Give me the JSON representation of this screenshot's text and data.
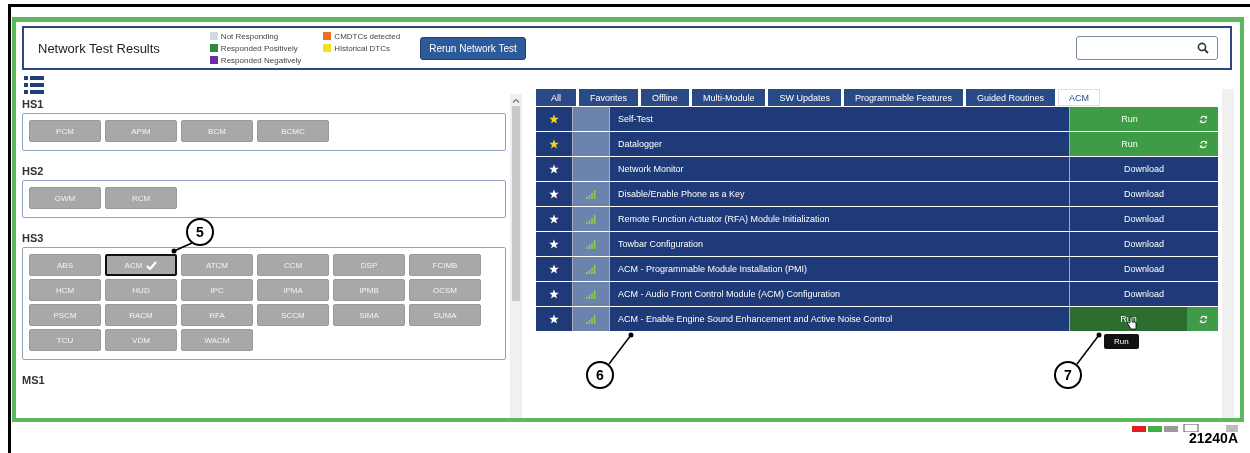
{
  "header": {
    "title": "Network Test Results",
    "legend": [
      {
        "label": "Not Responding",
        "color": "#d3d9e2"
      },
      {
        "label": "Responded Positively",
        "color": "#2e8b3e"
      },
      {
        "label": "Responded Negatively",
        "color": "#6a2fa0"
      },
      {
        "label": "CMDTCs detected",
        "color": "#f07020"
      },
      {
        "label": "Historical DTCs",
        "color": "#f5e020"
      }
    ],
    "rerun_button": "Rerun Network Test"
  },
  "groups": [
    {
      "name": "HS1",
      "modules": [
        {
          "label": "PCM",
          "selected": false
        },
        {
          "label": "APIM",
          "selected": false
        },
        {
          "label": "BCM",
          "selected": false
        },
        {
          "label": "BCMC",
          "selected": false
        }
      ]
    },
    {
      "name": "HS2",
      "modules": [
        {
          "label": "GWM",
          "selected": false
        },
        {
          "label": "RCM",
          "selected": false
        }
      ]
    },
    {
      "name": "HS3",
      "modules": [
        {
          "label": "ABS",
          "selected": false
        },
        {
          "label": "ACM",
          "selected": true
        },
        {
          "label": "ATCM",
          "selected": false
        },
        {
          "label": "CCM",
          "selected": false
        },
        {
          "label": "DSP",
          "selected": false
        },
        {
          "label": "FCIMB",
          "selected": false
        },
        {
          "label": "HCM",
          "selected": false
        },
        {
          "label": "HUD",
          "selected": false
        },
        {
          "label": "IPC",
          "selected": false
        },
        {
          "label": "IPMA",
          "selected": false
        },
        {
          "label": "IPMB",
          "selected": false
        },
        {
          "label": "OCSM",
          "selected": false
        },
        {
          "label": "PSCM",
          "selected": false
        },
        {
          "label": "RACM",
          "selected": false
        },
        {
          "label": "RFA",
          "selected": false
        },
        {
          "label": "SCCM",
          "selected": false
        },
        {
          "label": "SIMA",
          "selected": false
        },
        {
          "label": "SUMA",
          "selected": false
        },
        {
          "label": "TCU",
          "selected": false
        },
        {
          "label": "VDM",
          "selected": false
        },
        {
          "label": "WACM",
          "selected": false
        }
      ]
    },
    {
      "name": "MS1"
    }
  ],
  "tabs": [
    {
      "label": "All",
      "selected": false
    },
    {
      "label": "Favorites",
      "selected": false
    },
    {
      "label": "Offline",
      "selected": false
    },
    {
      "label": "Multi-Module",
      "selected": false
    },
    {
      "label": "SW Updates",
      "selected": false
    },
    {
      "label": "Programmable Features",
      "selected": false
    },
    {
      "label": "Guided Routines",
      "selected": false
    },
    {
      "label": "ACM",
      "selected": true
    }
  ],
  "rows": [
    {
      "favorite": true,
      "signal": false,
      "name": "Self-Test",
      "kind": "run",
      "action": "Run"
    },
    {
      "favorite": true,
      "signal": false,
      "name": "Datalogger",
      "kind": "run",
      "action": "Run"
    },
    {
      "favorite": false,
      "signal": false,
      "name": "Network Monitor",
      "kind": "download",
      "action": "Download"
    },
    {
      "favorite": false,
      "signal": true,
      "name": "Disable/Enable Phone as a Key",
      "kind": "download",
      "action": "Download"
    },
    {
      "favorite": false,
      "signal": true,
      "name": "Remote Function Actuator (RFA) Module Initialization",
      "kind": "download",
      "action": "Download"
    },
    {
      "favorite": false,
      "signal": true,
      "name": "Towbar Configuration",
      "kind": "download",
      "action": "Download"
    },
    {
      "favorite": false,
      "signal": true,
      "name": "ACM - Programmable Module Installation (PMI)",
      "kind": "download",
      "action": "Download"
    },
    {
      "favorite": false,
      "signal": true,
      "name": "ACM - Audio Front Control Module (ACM) Configuration",
      "kind": "download",
      "action": "Download"
    },
    {
      "favorite": false,
      "signal": true,
      "name": "ACM - Enable Engine Sound Enhancement and Active Noise Control",
      "kind": "run",
      "action": "Run",
      "hovered": true,
      "tooltip": "Run"
    }
  ],
  "callouts": [
    "5",
    "6",
    "7"
  ],
  "figure_number": "21240A"
}
